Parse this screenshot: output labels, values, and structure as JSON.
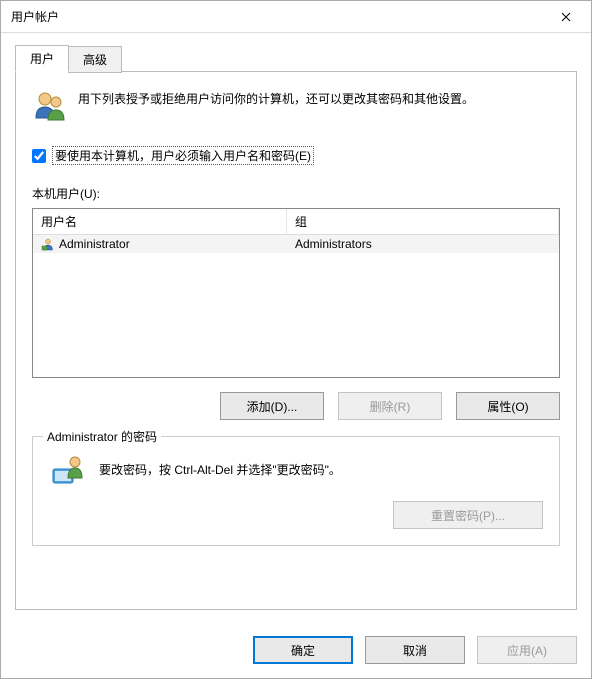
{
  "window": {
    "title": "用户帐户"
  },
  "tabs": {
    "users": "用户",
    "advanced": "高级"
  },
  "intro": {
    "text": "用下列表授予或拒绝用户访问你的计算机，还可以更改其密码和其他设置。"
  },
  "checkbox": {
    "label": "要使用本计算机，用户必须输入用户名和密码(E)"
  },
  "list": {
    "label": "本机用户(U):",
    "headers": {
      "user": "用户名",
      "group": "组"
    },
    "rows": [
      {
        "user": "Administrator",
        "group": "Administrators"
      }
    ]
  },
  "buttons": {
    "add": "添加(D)...",
    "remove": "删除(R)",
    "properties": "属性(O)"
  },
  "password": {
    "legend": "Administrator 的密码",
    "text": "要改密码，按 Ctrl-Alt-Del 并选择\"更改密码\"。",
    "reset": "重置密码(P)..."
  },
  "footer": {
    "ok": "确定",
    "cancel": "取消",
    "apply": "应用(A)"
  }
}
